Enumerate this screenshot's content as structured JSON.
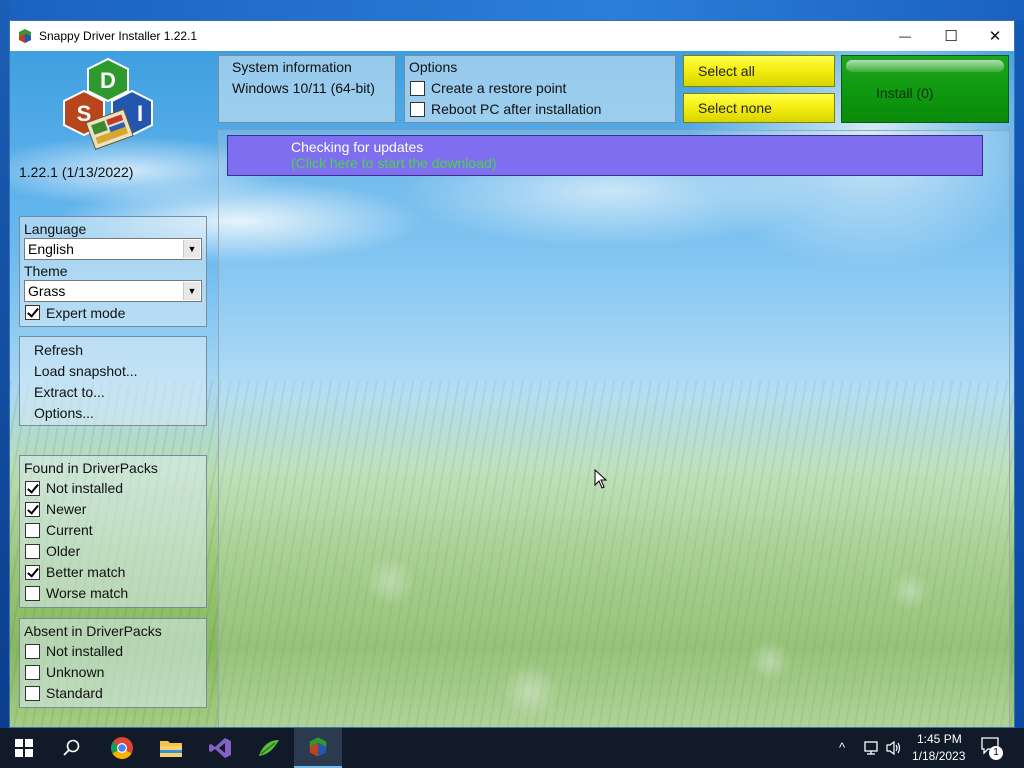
{
  "window": {
    "title": "Snappy Driver Installer 1.22.1",
    "minimize_glyph": "—",
    "maximize_glyph": "☐",
    "close_glyph": "✕"
  },
  "logo": {
    "letter_top": "D",
    "letter_left": "S",
    "letter_right": "I",
    "colors": {
      "green": "#2e9a2e",
      "red": "#b8451c",
      "blue": "#2456b0"
    }
  },
  "version": "1.22.1 (1/13/2022)",
  "settings": {
    "language_label": "Language",
    "language_value": "English",
    "theme_label": "Theme",
    "theme_value": "Grass",
    "expert_mode_label": "Expert mode",
    "expert_mode_checked": true
  },
  "menu": {
    "items": [
      "Refresh",
      "Load snapshot...",
      "Extract to...",
      "Options..."
    ]
  },
  "found": {
    "header": "Found in DriverPacks",
    "items": [
      {
        "label": "Not installed",
        "checked": true
      },
      {
        "label": "Newer",
        "checked": true
      },
      {
        "label": "Current",
        "checked": false
      },
      {
        "label": "Older",
        "checked": false
      },
      {
        "label": "Better match",
        "checked": true
      },
      {
        "label": "Worse match",
        "checked": false
      }
    ]
  },
  "absent": {
    "header": "Absent in DriverPacks",
    "items": [
      {
        "label": "Not installed",
        "checked": false
      },
      {
        "label": "Unknown",
        "checked": false
      },
      {
        "label": "Standard",
        "checked": false
      }
    ]
  },
  "system_info": {
    "header": "System information",
    "os": "Windows 10/11 (64-bit)"
  },
  "options": {
    "header": "Options",
    "items": [
      {
        "label": "Create a restore point",
        "checked": false
      },
      {
        "label": "Reboot PC after installation",
        "checked": false
      }
    ]
  },
  "buttons": {
    "select_all": "Select all",
    "select_none": "Select none",
    "install": "Install (0)"
  },
  "update": {
    "title": "Checking for updates",
    "link": "(Click here to start the download)"
  },
  "taskbar": {
    "apps": [
      "start-button",
      "search",
      "chrome",
      "file-explorer",
      "visual-studio",
      "snappy-driver-grass",
      "snappy-driver-installer"
    ],
    "tray_chevron": "^",
    "time": "1:45 PM",
    "date": "1/18/2023",
    "notification_count": "1"
  }
}
